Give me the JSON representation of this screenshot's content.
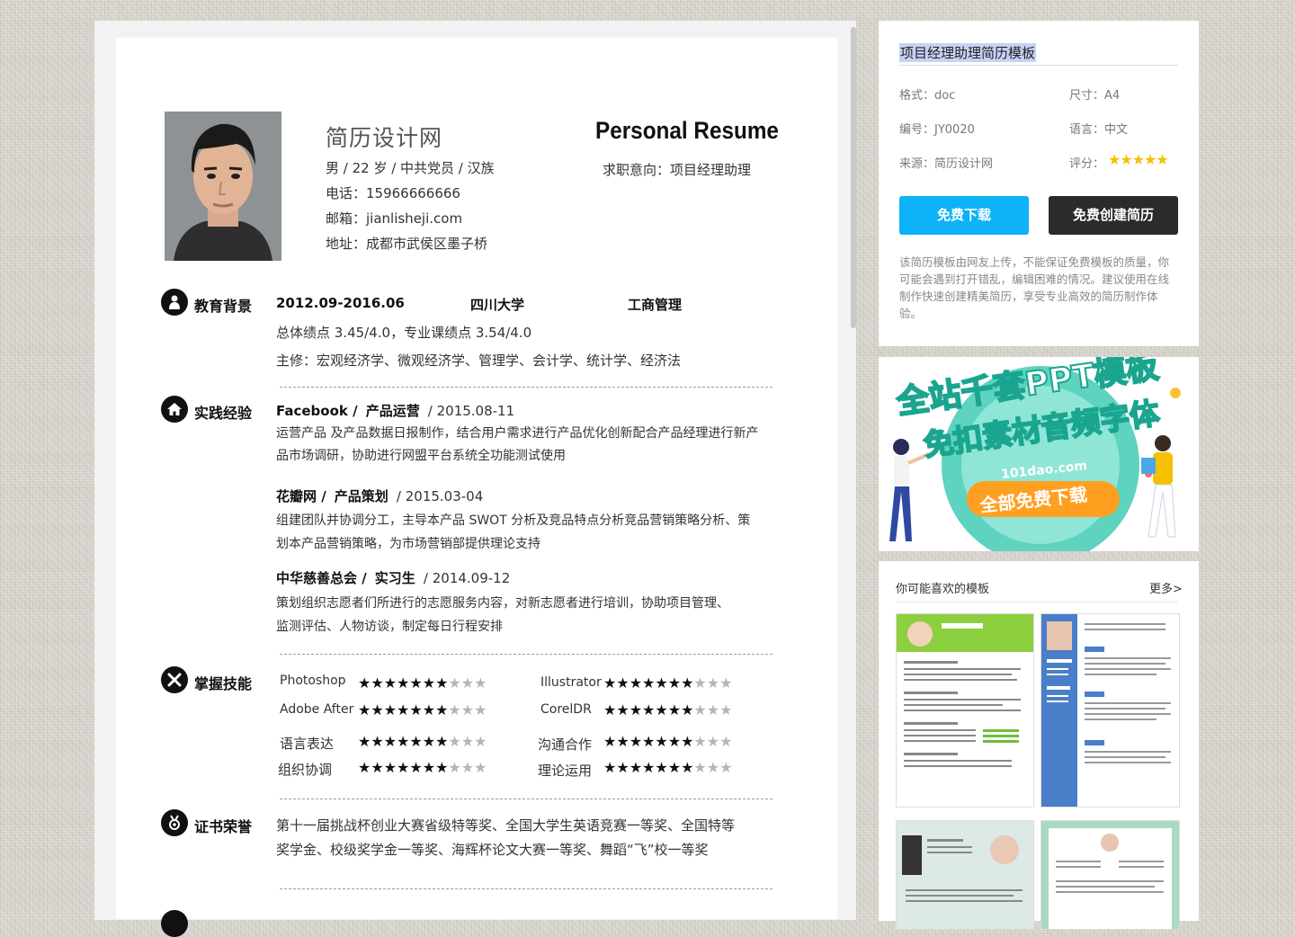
{
  "resume": {
    "site_name": "简历设计网",
    "title_en": "Personal Resume",
    "basic": "男  / 22 岁  /  中共党员  /  汉族",
    "phone": "电话：15966666666",
    "email": "邮箱：jianlisheji.com",
    "address": "地址：成都市武侯区墨子桥",
    "objective": "求职意向：项目经理助理",
    "education": {
      "title": "教育背景",
      "period": "2012.09-2016.06",
      "school": "四川大学",
      "major": "工商管理",
      "gpa": "总体绩点    3.45/4.0，专业课绩点    3.54/4.0",
      "courses": "主修：宏观经济学、微观经济学、管理学、会计学、统计学、经济法"
    },
    "experience": {
      "title": "实践经验",
      "items": [
        {
          "company": "Facebook /",
          "role": "产品运营",
          "date": "/ 2015.08-11",
          "line1": "运营产品  及产品数据日报制作，结合用户需求进行产品优化创新配合产品经理进行新产",
          "line2": "品市场调研，协助进行网盟平台系统全功能测试使用"
        },
        {
          "company": "花瓣网  /",
          "role": "产品策划",
          "date": "/ 2015.03-04",
          "line1": "组建团队并协调分工，主导本产品 SWOT 分析及竞品特点分析竞品营销策略分析、策",
          "line2": "划本产品营销策略，为市场营销部提供理论支持"
        },
        {
          "company": "中华慈善总会  /",
          "role": "实习生",
          "date": "/ 2014.09-12",
          "line1": "策划组织志愿者们所进行的志愿服务内容，对新志愿者进行培训，协助项目管理、",
          "line2": "监测评估、人物访谈，制定每日行程安排"
        }
      ]
    },
    "skills": {
      "title": "掌握技能",
      "items": [
        {
          "name": "Photoshop",
          "rating": 7,
          "max": 10
        },
        {
          "name": "Illustrator",
          "rating": 7,
          "max": 10
        },
        {
          "name": "Adobe After",
          "rating": 7,
          "max": 10
        },
        {
          "name": "CorelDR",
          "rating": 7,
          "max": 10
        },
        {
          "name": "语言表达",
          "rating": 7,
          "max": 10
        },
        {
          "name": "沟通合作",
          "rating": 7,
          "max": 10
        },
        {
          "name": "组织协调",
          "rating": 7,
          "max": 10
        },
        {
          "name": "理论运用",
          "rating": 7,
          "max": 10
        }
      ]
    },
    "awards": {
      "title": "证书荣誉",
      "line1": "第十一届挑战杯创业大赛省级特等奖、全国大学生英语竞赛一等奖、全国特等",
      "line2": "奖学金、校级奖学金一等奖、海辉杯论文大赛一等奖、舞蹈“飞”校一等奖"
    }
  },
  "sidebar": {
    "title": "项目经理助理简历模板",
    "format": "格式：doc",
    "size": "尺寸：A4",
    "code": "编号：JY0020",
    "language": "语言：中文",
    "source": "来源：简历设计网",
    "rating_label": "评分：",
    "rating_stars": 5,
    "btn_download": "免费下载",
    "btn_create": "免费创建简历",
    "description": "该简历模板由网友上传，不能保证免费模板的质量，你可能会遇到打开错乱，编辑困难的情况。建议使用在线制作快速创建精美简历，享受专业高效的简历制作体验。",
    "colors": {
      "download": "#0db3f6",
      "create": "#2b2b2b",
      "star": "#f6c000"
    }
  },
  "banner": {
    "line1": "全站千套PPT模板",
    "line2": "免扣素材音频字体",
    "url": "101dao.com",
    "cta": "全部免费下载"
  },
  "related": {
    "title": "你可能喜欢的模板",
    "more": "更多>"
  }
}
